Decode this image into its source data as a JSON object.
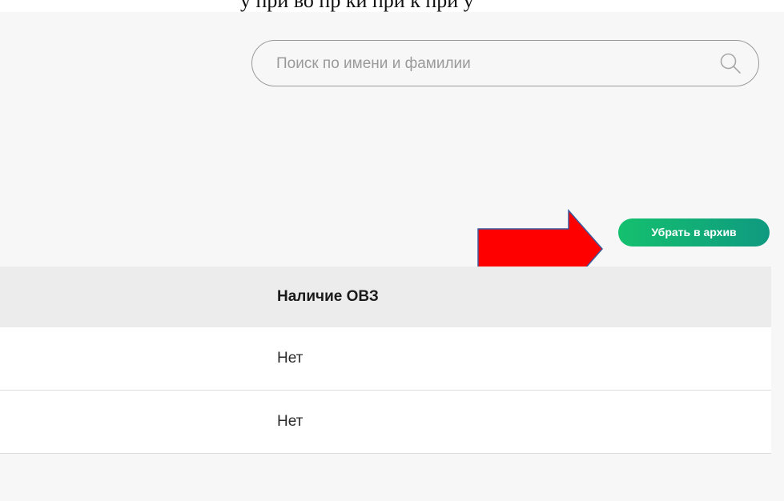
{
  "document_strip": {
    "text": "у при во пр ки при к при у"
  },
  "search": {
    "placeholder": "Поиск по имени и фамилии",
    "value": "",
    "icon": "search-icon"
  },
  "toolbar": {
    "archive_label": "Убрать в архив"
  },
  "annotation": {
    "arrow_color": "#ff0000",
    "arrow_outline": "#3a5a9c"
  },
  "table": {
    "columns": [
      "Наличие ОВЗ"
    ],
    "rows": [
      {
        "ovz": "Нет"
      },
      {
        "ovz": "Нет"
      }
    ]
  },
  "colors": {
    "accent_start": "#14c06e",
    "accent_end": "#0f9a80",
    "background": "#f7f7f7",
    "header_bg": "#ececec"
  }
}
